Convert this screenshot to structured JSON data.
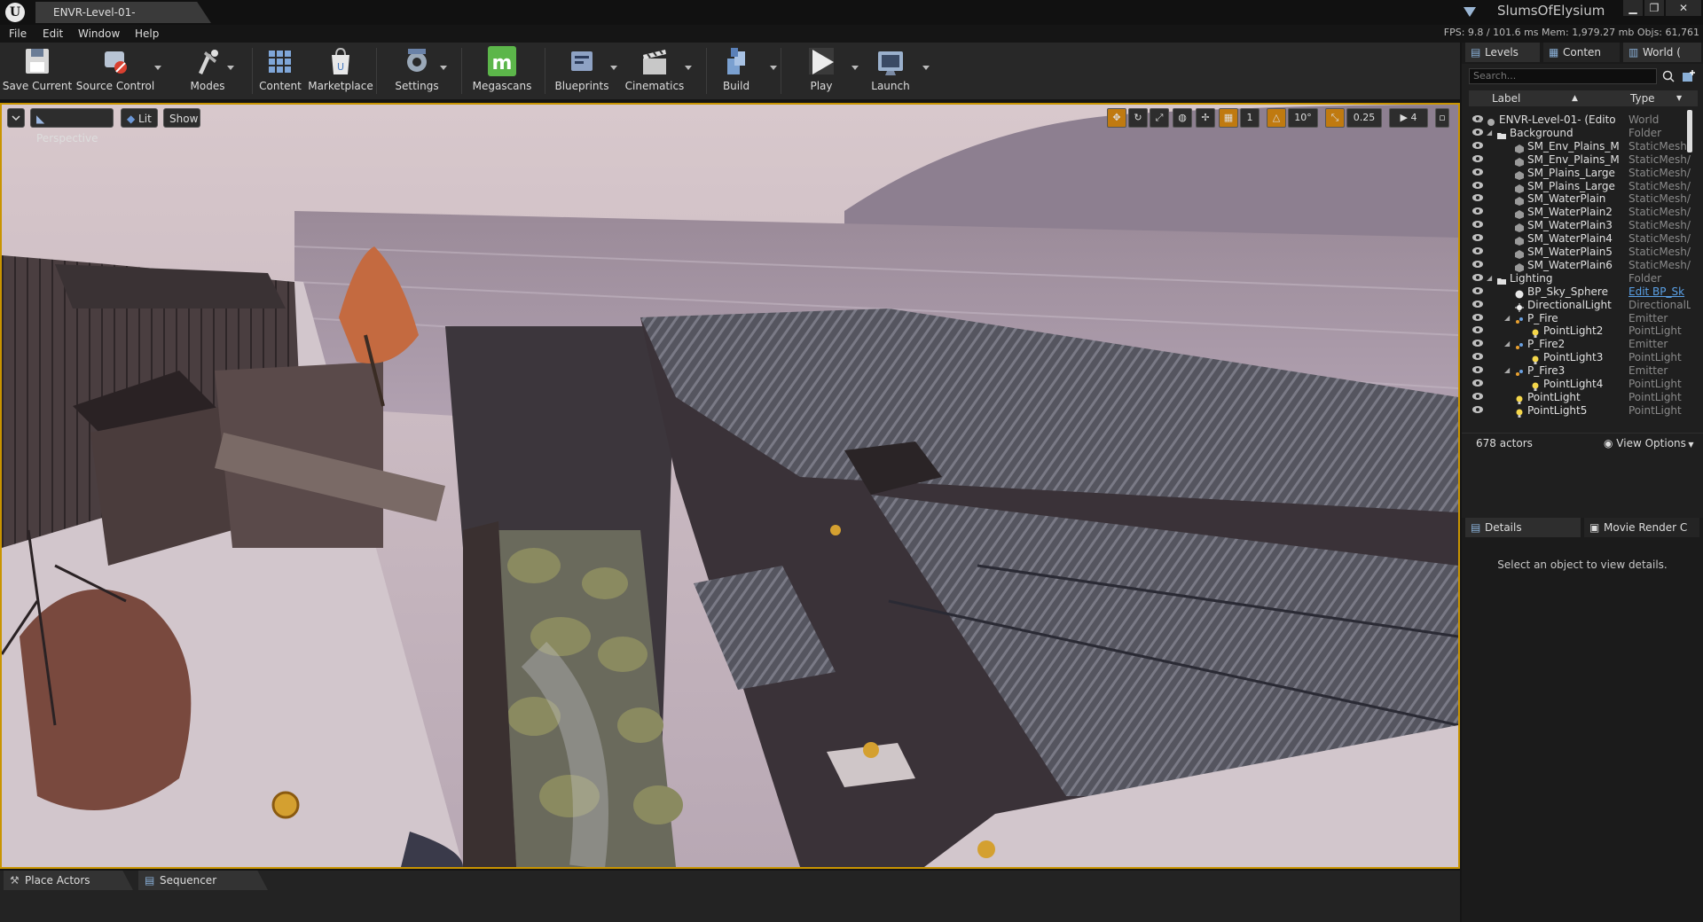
{
  "window": {
    "tab_title": "ENVR-Level-01-",
    "project_name": "SlumsOfElysium",
    "controls": [
      "▁",
      "❐",
      "✕"
    ]
  },
  "menu": [
    "File",
    "Edit",
    "Window",
    "Help"
  ],
  "stats": "FPS: 9.8  / 101.6 ms  Mem: 1,979.27 mb  Objs: 61,761",
  "toolbar": [
    {
      "label": "Save Current",
      "icon": "save-icon",
      "dropdown": false
    },
    {
      "label": "Source Control",
      "icon": "source-control-icon",
      "dropdown": true
    },
    {
      "label": "Modes",
      "icon": "modes-icon",
      "dropdown": true
    },
    {
      "label": "Content",
      "icon": "content-icon",
      "dropdown": false
    },
    {
      "label": "Marketplace",
      "icon": "marketplace-icon",
      "dropdown": false
    },
    {
      "label": "Settings",
      "icon": "settings-icon",
      "dropdown": true
    },
    {
      "label": "Megascans",
      "icon": "megascans-icon",
      "dropdown": false
    },
    {
      "label": "Blueprints",
      "icon": "blueprints-icon",
      "dropdown": true
    },
    {
      "label": "Cinematics",
      "icon": "cinematics-icon",
      "dropdown": true
    },
    {
      "label": "Build",
      "icon": "build-icon",
      "dropdown": true
    },
    {
      "label": "Play",
      "icon": "play-icon",
      "dropdown": true
    },
    {
      "label": "Launch",
      "icon": "launch-icon",
      "dropdown": true
    }
  ],
  "viewport": {
    "view_mode": "Perspective",
    "lighting": "Lit",
    "show": "Show",
    "rotation_snap": "10°",
    "scale_snap": "0.25",
    "camera_speed": "4",
    "grid_count": "1"
  },
  "bottom_tabs": [
    "Place Actors",
    "Sequencer"
  ],
  "right_panel": {
    "tabs": [
      "Levels",
      "Conten",
      "World ("
    ],
    "search_placeholder": "Search...",
    "columns": {
      "label": "Label",
      "type": "Type"
    },
    "rows": [
      {
        "name": "ENVR-Level-01- (Edito",
        "type": "World",
        "kind": "world"
      },
      {
        "name": "Background",
        "type": "Folder",
        "kind": "folder"
      },
      {
        "name": "SM_Env_Plains_M",
        "type": "StaticMesh/",
        "kind": "mesh"
      },
      {
        "name": "SM_Env_Plains_M",
        "type": "StaticMesh/",
        "kind": "mesh"
      },
      {
        "name": "SM_Plains_Large",
        "type": "StaticMesh/",
        "kind": "mesh"
      },
      {
        "name": "SM_Plains_Large",
        "type": "StaticMesh/",
        "kind": "mesh"
      },
      {
        "name": "SM_WaterPlain",
        "type": "StaticMesh/",
        "kind": "mesh"
      },
      {
        "name": "SM_WaterPlain2",
        "type": "StaticMesh/",
        "kind": "mesh"
      },
      {
        "name": "SM_WaterPlain3",
        "type": "StaticMesh/",
        "kind": "mesh"
      },
      {
        "name": "SM_WaterPlain4",
        "type": "StaticMesh/",
        "kind": "mesh"
      },
      {
        "name": "SM_WaterPlain5",
        "type": "StaticMesh/",
        "kind": "mesh"
      },
      {
        "name": "SM_WaterPlain6",
        "type": "StaticMesh/",
        "kind": "mesh"
      },
      {
        "name": "Lighting",
        "type": "Folder",
        "kind": "folder"
      },
      {
        "name": "BP_Sky_Sphere",
        "type": "Edit BP_Sk",
        "kind": "sphere"
      },
      {
        "name": "DirectionalLight",
        "type": "DirectionalL",
        "kind": "sun"
      },
      {
        "name": "P_Fire",
        "type": "Emitter",
        "kind": "emitter"
      },
      {
        "name": "PointLight2",
        "type": "PointLight",
        "kind": "light"
      },
      {
        "name": "P_Fire2",
        "type": "Emitter",
        "kind": "emitter"
      },
      {
        "name": "PointLight3",
        "type": "PointLight",
        "kind": "light"
      },
      {
        "name": "P_Fire3",
        "type": "Emitter",
        "kind": "emitter"
      },
      {
        "name": "PointLight4",
        "type": "PointLight",
        "kind": "light"
      },
      {
        "name": "PointLight",
        "type": "PointLight",
        "kind": "light"
      },
      {
        "name": "PointLight5",
        "type": "PointLight",
        "kind": "light"
      }
    ],
    "actor_count": "678 actors",
    "view_options": "View Options",
    "details_tabs": [
      "Details",
      "Movie Render C"
    ],
    "details_message": "Select an object to view details."
  },
  "colors": {
    "selection_border": "#c99400",
    "link": "#5aa0e6",
    "megascans_green": "#5cb64a"
  }
}
